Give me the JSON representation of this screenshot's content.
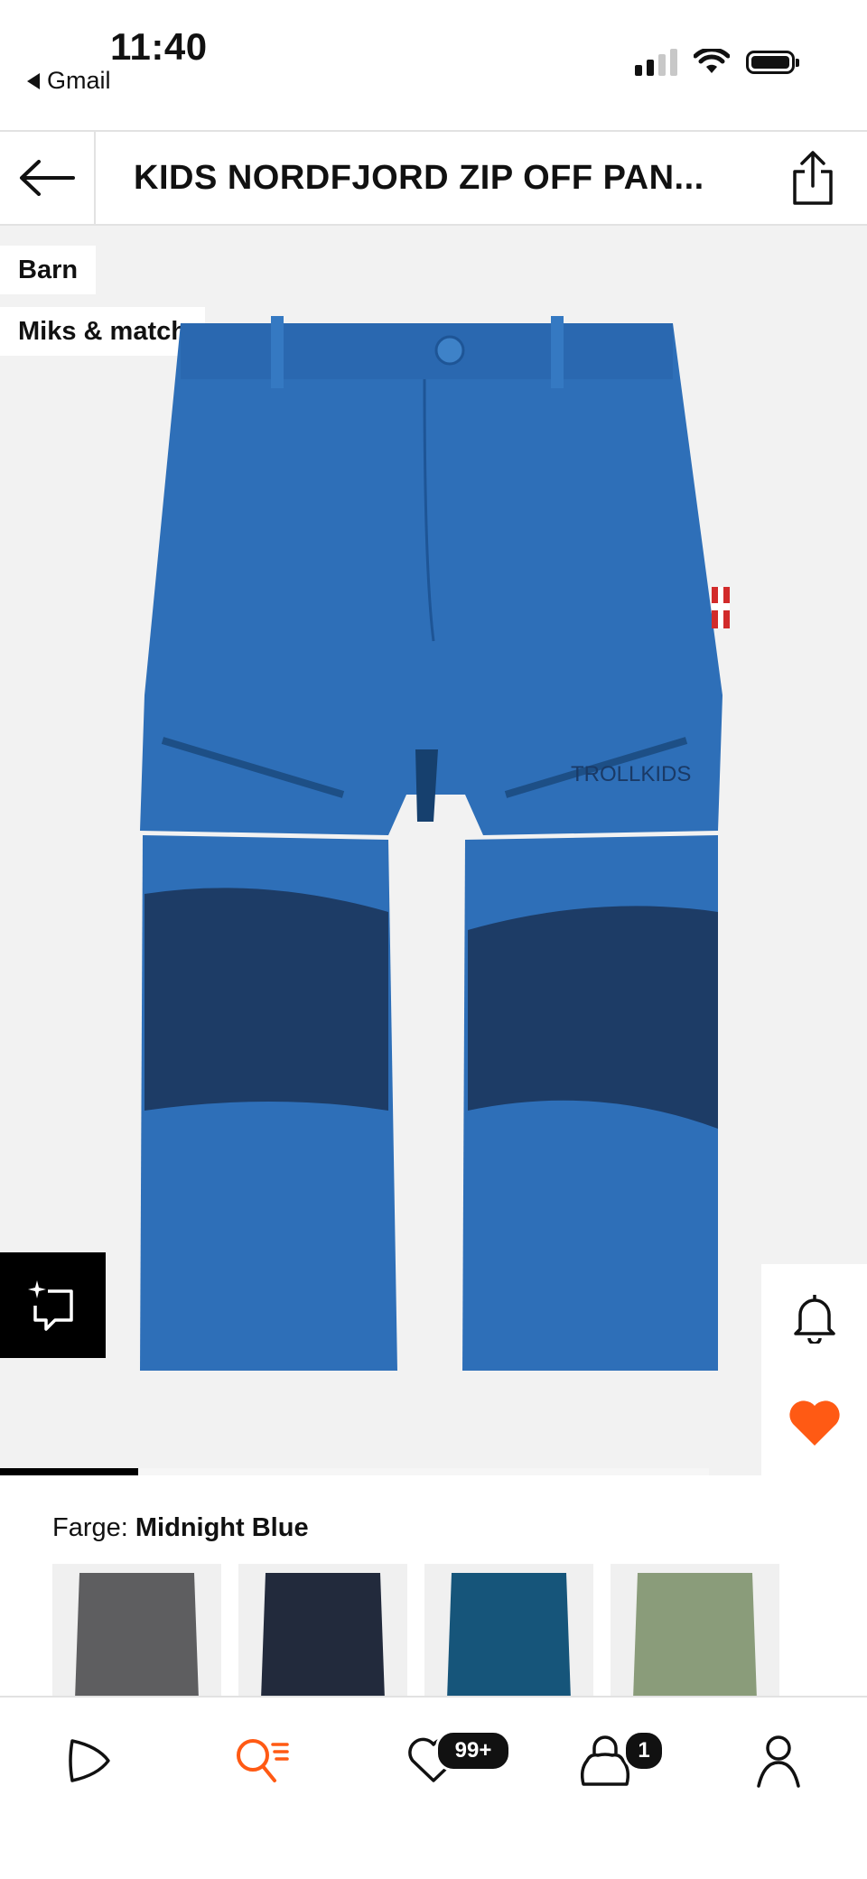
{
  "status_bar": {
    "time": "11:40",
    "back_app": "Gmail"
  },
  "header": {
    "title": "KIDS NORDFJORD ZIP OFF PAN..."
  },
  "gallery": {
    "tags": [
      "Barn",
      "Miks & match"
    ],
    "brand_logo_text": "TROLLKIDS",
    "progress": 0.25
  },
  "color": {
    "label": "Farge:",
    "selected": "Midnight Blue",
    "swatches": [
      {
        "name": "grey",
        "color": "#5e5e60"
      },
      {
        "name": "navy",
        "color": "#222a3c"
      },
      {
        "name": "petrol",
        "color": "#16557a"
      },
      {
        "name": "green",
        "color": "#8a9c7a"
      }
    ]
  },
  "nav": {
    "wishlist_badge": "99+",
    "bag_badge": "1"
  },
  "colors": {
    "accent": "#ff5a14",
    "product_blue": "#2e6fb8",
    "panel_navy": "#1d3c66"
  }
}
